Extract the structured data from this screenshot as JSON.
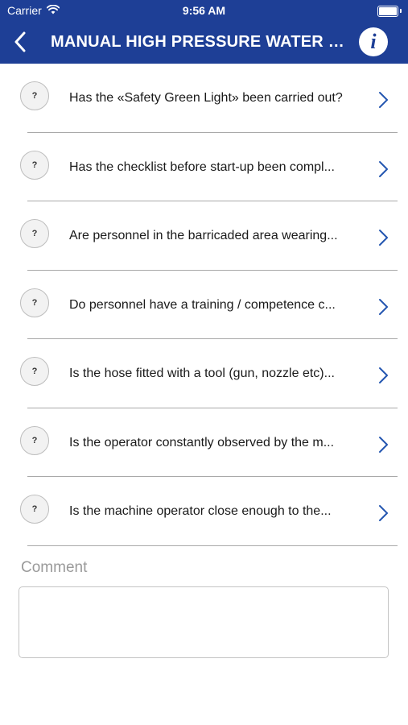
{
  "status_bar": {
    "carrier": "Carrier",
    "time": "9:56 AM",
    "icons": [
      "wifi-icon",
      "battery-icon"
    ]
  },
  "nav": {
    "title": "MANUAL HIGH PRESSURE WATER J...",
    "back_icon": "chevron-left-icon",
    "info_icon": "info-icon",
    "info_glyph": "i"
  },
  "colors": {
    "header_bg": "#1e3f96",
    "chevron": "#2456b0"
  },
  "questions": [
    {
      "status": "?",
      "text": "Has the «Safety Green Light» been carried out?"
    },
    {
      "status": "?",
      "text": "Has the checklist before start-up been compl..."
    },
    {
      "status": "?",
      "text": "Are personnel in the barricaded area wearing..."
    },
    {
      "status": "?",
      "text": "Do personnel have a training / competence c..."
    },
    {
      "status": "?",
      "text": "Is the hose fitted with a tool (gun, nozzle etc)..."
    },
    {
      "status": "?",
      "text": "Is the operator constantly observed by the m..."
    },
    {
      "status": "?",
      "text": "Is the machine operator close enough to the..."
    }
  ],
  "comment": {
    "label": "Comment",
    "value": ""
  }
}
